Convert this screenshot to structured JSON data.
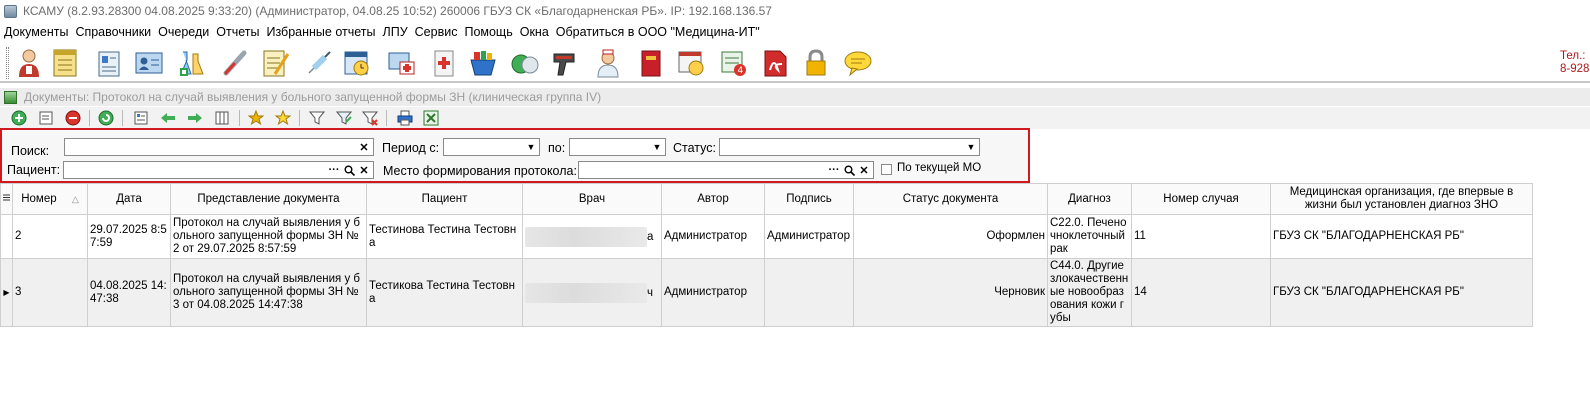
{
  "window": {
    "title": "КСАМУ (8.2.93.28300 04.08.2025 9:33:20) (Администратор, 04.08.25 10:52)  260006 ГБУЗ СК «Благодарненская РБ». IP: 192.168.136.57"
  },
  "menu": [
    "Документы",
    "Справочники",
    "Очереди",
    "Отчеты",
    "Избранные отчеты",
    "ЛПУ",
    "Сервис",
    "Помощь",
    "Окна",
    "Обратиться в ООО \"Медицина-ИТ\""
  ],
  "phone": {
    "line1": "Тел.:",
    "line2": "8-928"
  },
  "document": {
    "title": "Документы: Протокол на случай выявления у больного запущенной формы ЗН (клиническая группа IV)"
  },
  "filter": {
    "search_label": "Поиск:",
    "search_value": "",
    "period_from_label": "Период с:",
    "period_to_label": "по:",
    "status_label": "Статус:",
    "patient_label": "Пациент:",
    "place_label": "Место формирования протокола:",
    "current_mo_label": "По текущей МО",
    "current_mo_checked": false
  },
  "table": {
    "columns": [
      "Номер",
      "Дата",
      "Представление документа",
      "Пациент",
      "Врач",
      "Автор",
      "Подпись",
      "Статус документа",
      "Диагноз",
      "Номер случая",
      "Медицинская организация, где впервые в жизни был установлен диагноз ЗНО"
    ],
    "rows": [
      {
        "number": "2",
        "date": "29.07.2025 8:57:59",
        "doc": "Протокол на случай выявления у больного запущенной формы ЗН № 2 от 29.07.2025 8:57:59",
        "patient": "Тестинова Тестина Тестовна",
        "doctor_tail": "а",
        "author": "Администратор",
        "signature": "Администратор",
        "status": "Оформлен",
        "diagnosis": "C22.0. Печеночноклеточный рак",
        "case": "11",
        "org": "ГБУЗ СК \"БЛАГОДАРНЕНСКАЯ РБ\""
      },
      {
        "number": "3",
        "date": "04.08.2025 14:47:38",
        "doc": "Протокол на случай выявления у больного запущенной формы ЗН № 3 от 04.08.2025 14:47:38",
        "patient": "Тестикова Тестина Тестовна",
        "doctor_tail": "ч",
        "author": "Администратор",
        "signature": "",
        "status": "Черновик",
        "diagnosis": "C44.0. Другие злокачественные новообразования кожи губы",
        "case": "14",
        "org": "ГБУЗ СК \"БЛАГОДАРНЕНСКАЯ РБ\""
      }
    ]
  }
}
